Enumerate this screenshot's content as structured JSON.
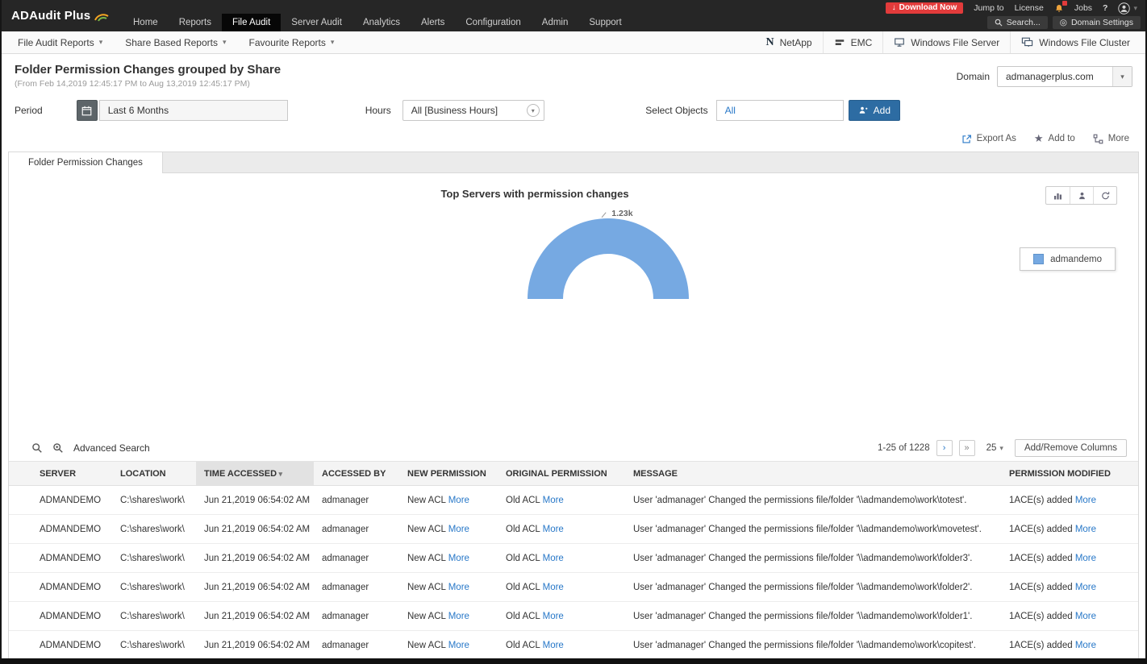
{
  "topbar": {
    "logo": "ADAudit Plus",
    "nav": [
      "Home",
      "Reports",
      "File Audit",
      "Server Audit",
      "Analytics",
      "Alerts",
      "Configuration",
      "Admin",
      "Support"
    ],
    "active_nav": "File Audit",
    "download_now": "Download Now",
    "jump_to": "Jump to",
    "license": "License",
    "jobs": "Jobs",
    "help": "?",
    "search": "Search...",
    "domain_settings": "Domain Settings"
  },
  "toolbar": {
    "menus": [
      "File Audit Reports",
      "Share Based Reports",
      "Favourite Reports"
    ],
    "right_items": [
      "NetApp",
      "EMC",
      "Windows File Server",
      "Windows File Cluster"
    ]
  },
  "page": {
    "title": "Folder Permission Changes grouped by Share",
    "subtitle": "(From Feb 14,2019 12:45:17 PM to Aug 13,2019 12:45:17 PM)",
    "domain_label": "Domain",
    "domain_value": "admanagerplus.com"
  },
  "filters": {
    "period_label": "Period",
    "period_value": "Last 6 Months",
    "hours_label": "Hours",
    "hours_value": "All [Business Hours]",
    "select_objects_label": "Select Objects",
    "select_objects_value": "All",
    "add_button": "Add"
  },
  "actions": {
    "export_as": "Export As",
    "add_to": "Add to",
    "more": "More"
  },
  "report_tab": "Folder Permission Changes",
  "chart_data": {
    "type": "pie",
    "variant": "half-donut",
    "title": "Top Servers with permission changes",
    "categories": [
      "admandemo"
    ],
    "values": [
      1230
    ],
    "value_labels": [
      "1.23k"
    ],
    "legend": [
      "admandemo"
    ],
    "legend_position": "right",
    "color": "#76a9e2"
  },
  "table": {
    "advanced_search": "Advanced Search",
    "pagination": "1-25 of 1228",
    "page_size": "25",
    "add_remove_columns": "Add/Remove Columns",
    "more_label": "More",
    "headers": [
      "SERVER",
      "LOCATION",
      "TIME ACCESSED",
      "ACCESSED BY",
      "NEW PERMISSION",
      "ORIGINAL PERMISSION",
      "MESSAGE",
      "PERMISSION MODIFIED"
    ],
    "sorted_header": "TIME ACCESSED",
    "rows": [
      {
        "server": "ADMANDEMO",
        "location": "C:\\shares\\work\\",
        "time_accessed": "Jun 21,2019 06:54:02 AM",
        "accessed_by": "admanager",
        "new_permission": "New ACL",
        "original_permission": "Old ACL",
        "message": "User 'admanager' Changed the permissions file/folder '\\\\admandemo\\work\\totest'.",
        "permission_modified": "1ACE(s) added"
      },
      {
        "server": "ADMANDEMO",
        "location": "C:\\shares\\work\\",
        "time_accessed": "Jun 21,2019 06:54:02 AM",
        "accessed_by": "admanager",
        "new_permission": "New ACL",
        "original_permission": "Old ACL",
        "message": "User 'admanager' Changed the permissions file/folder '\\\\admandemo\\work\\movetest'.",
        "permission_modified": "1ACE(s) added"
      },
      {
        "server": "ADMANDEMO",
        "location": "C:\\shares\\work\\",
        "time_accessed": "Jun 21,2019 06:54:02 AM",
        "accessed_by": "admanager",
        "new_permission": "New ACL",
        "original_permission": "Old ACL",
        "message": "User 'admanager' Changed the permissions file/folder '\\\\admandemo\\work\\folder3'.",
        "permission_modified": "1ACE(s) added"
      },
      {
        "server": "ADMANDEMO",
        "location": "C:\\shares\\work\\",
        "time_accessed": "Jun 21,2019 06:54:02 AM",
        "accessed_by": "admanager",
        "new_permission": "New ACL",
        "original_permission": "Old ACL",
        "message": "User 'admanager' Changed the permissions file/folder '\\\\admandemo\\work\\folder2'.",
        "permission_modified": "1ACE(s) added"
      },
      {
        "server": "ADMANDEMO",
        "location": "C:\\shares\\work\\",
        "time_accessed": "Jun 21,2019 06:54:02 AM",
        "accessed_by": "admanager",
        "new_permission": "New ACL",
        "original_permission": "Old ACL",
        "message": "User 'admanager' Changed the permissions file/folder '\\\\admandemo\\work\\folder1'.",
        "permission_modified": "1ACE(s) added"
      },
      {
        "server": "ADMANDEMO",
        "location": "C:\\shares\\work\\",
        "time_accessed": "Jun 21,2019 06:54:02 AM",
        "accessed_by": "admanager",
        "new_permission": "New ACL",
        "original_permission": "Old ACL",
        "message": "User 'admanager' Changed the permissions file/folder '\\\\admandemo\\work\\copitest'.",
        "permission_modified": "1ACE(s) added"
      }
    ]
  },
  "colors": {
    "topbar_bg": "#262626",
    "download_red": "#e23b3b",
    "link_blue": "#2878c8",
    "add_button_blue": "#2d6ca3",
    "chart_blue": "#76a9e2"
  }
}
